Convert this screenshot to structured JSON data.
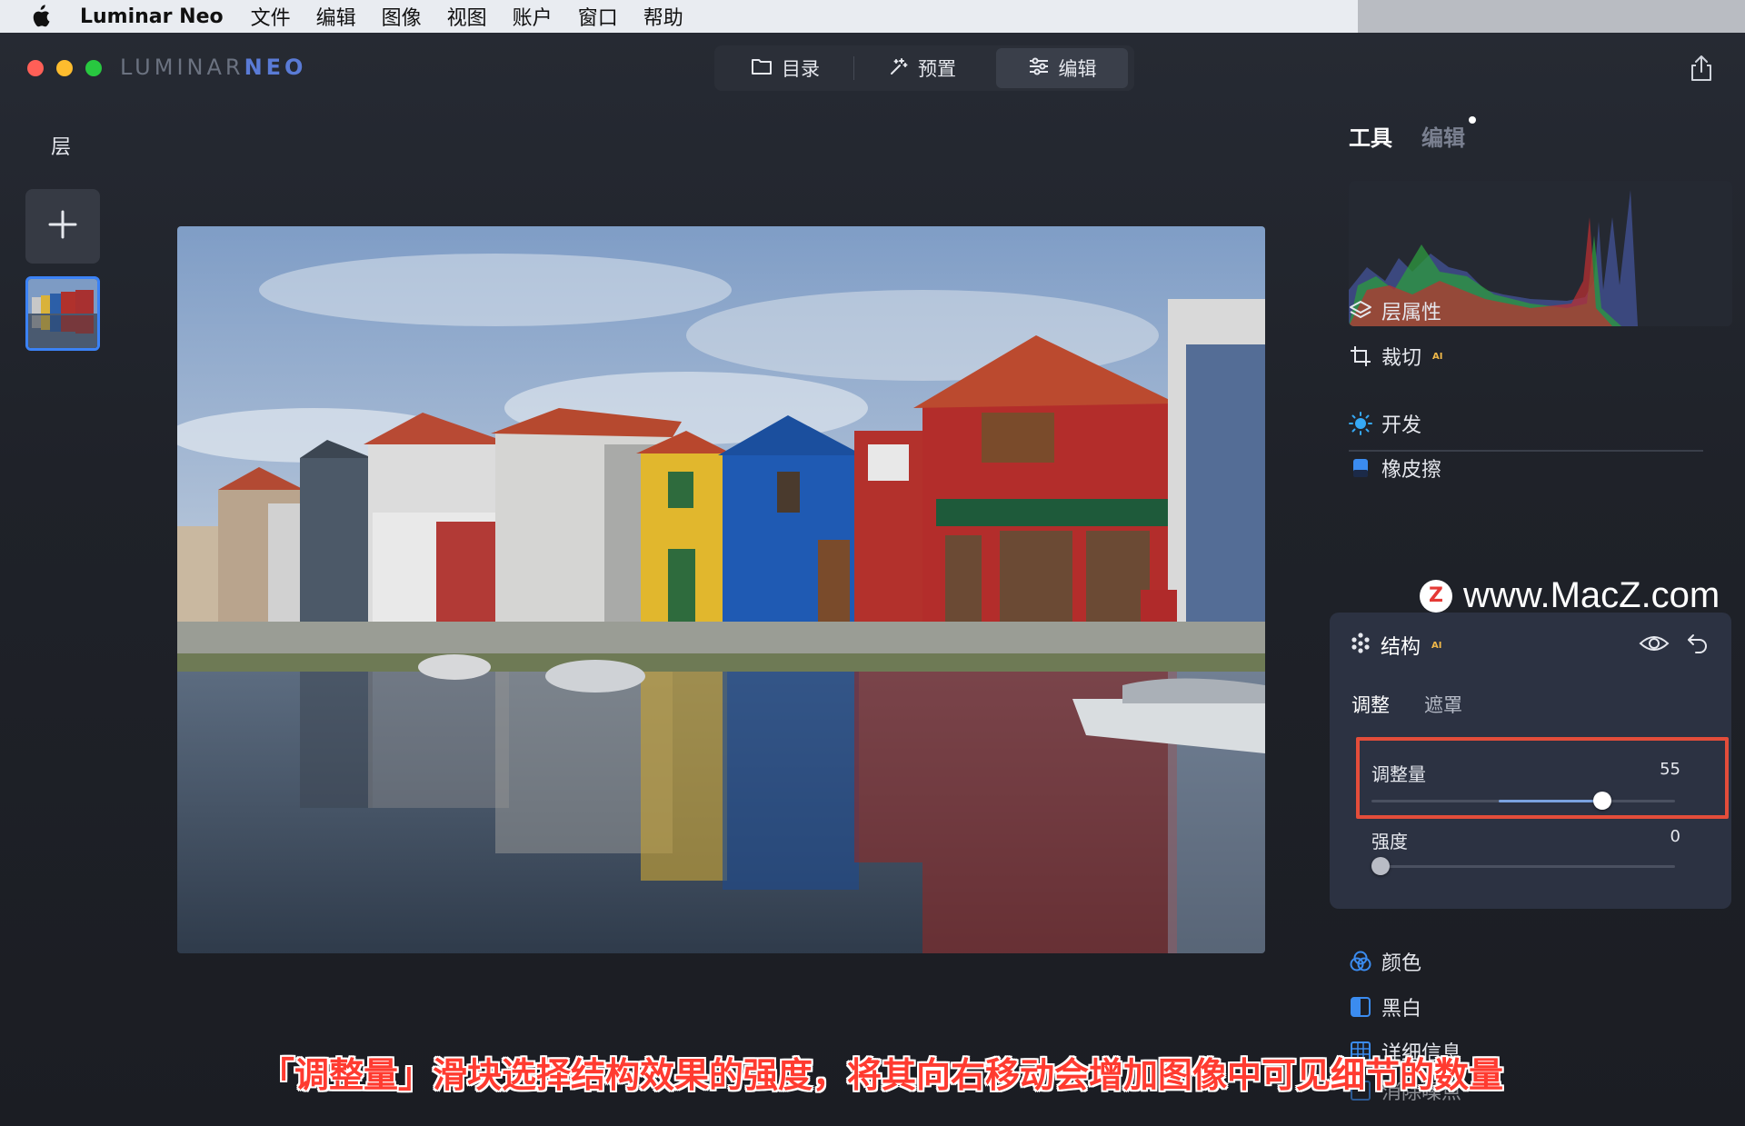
{
  "menubar": {
    "app_name": "Luminar Neo",
    "items": [
      "文件",
      "编辑",
      "图像",
      "视图",
      "账户",
      "窗口",
      "帮助"
    ]
  },
  "window": {
    "logo_main": "LUMINAR",
    "logo_sub": "NEO",
    "mode_tabs": [
      {
        "label": "目录",
        "icon": "folder-icon"
      },
      {
        "label": "预置",
        "icon": "sparkle-icon"
      },
      {
        "label": "编辑",
        "icon": "sliders-icon",
        "active": true
      }
    ]
  },
  "layers": {
    "title": "层"
  },
  "panel": {
    "tabs": {
      "tools": "工具",
      "edits": "编辑"
    },
    "tools": [
      {
        "label": "层属性",
        "icon": "layers-icon"
      },
      {
        "label": "裁切",
        "icon": "crop-icon",
        "ai": "AI"
      },
      {
        "label": "开发",
        "icon": "sun-icon"
      },
      {
        "label": "橡皮擦",
        "icon": "eraser-icon"
      }
    ],
    "structure": {
      "title": "结构",
      "ai": "AI",
      "sub_tabs": [
        "调整",
        "遮罩"
      ],
      "sliders": [
        {
          "label": "调整量",
          "value": "55",
          "fraction": 0.76
        },
        {
          "label": "强度",
          "value": "0",
          "fraction": 0.0
        }
      ]
    },
    "tools_bottom": [
      {
        "label": "颜色",
        "icon": "color-icon"
      },
      {
        "label": "黑白",
        "icon": "bw-icon"
      },
      {
        "label": "详细信息",
        "icon": "details-icon"
      },
      {
        "label": "消除噪点",
        "icon": "denoise-icon"
      }
    ]
  },
  "watermark": "www.MacZ.com",
  "caption": "「调整量」滑块选择结构效果的强度，将其向右移动会增加图像中可见细节的数量",
  "colors": {
    "accent": "#3b82f6",
    "highlight": "#e44d3a",
    "caption": "#ff3b30"
  }
}
